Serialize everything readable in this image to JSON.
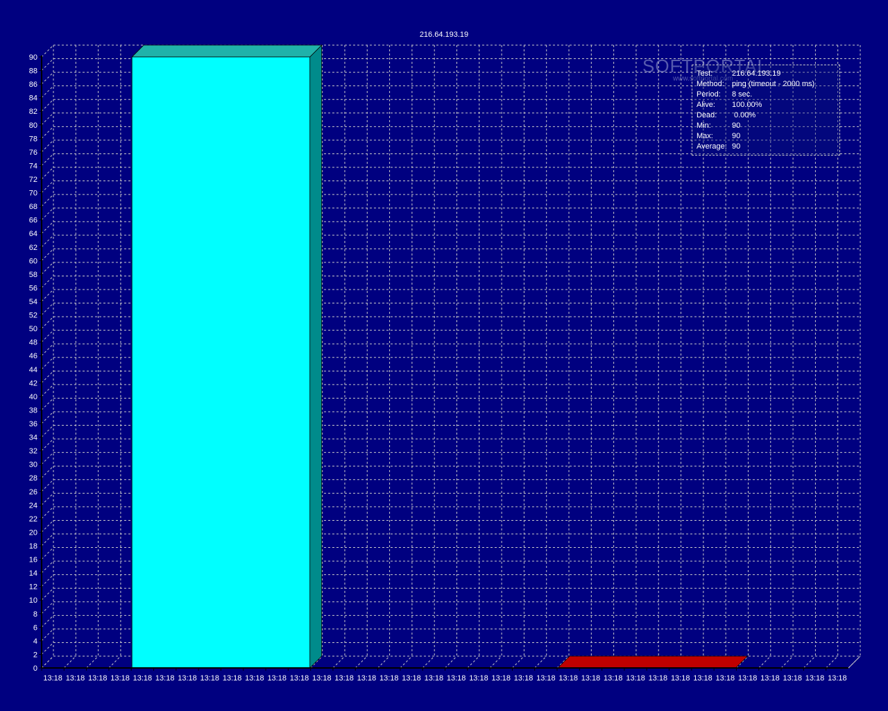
{
  "chart_data": {
    "type": "bar",
    "title": "216.64.193.19",
    "xlabel": "",
    "ylabel": "",
    "ylim": [
      0,
      90
    ],
    "ytick_step": 2,
    "grid": true,
    "style": "3d",
    "categories": [
      "13:18",
      "13:18",
      "13:18",
      "13:18",
      "13:18",
      "13:18",
      "13:18",
      "13:18",
      "13:18",
      "13:18",
      "13:18",
      "13:18",
      "13:18",
      "13:18",
      "13:18",
      "13:18",
      "13:18",
      "13:18",
      "13:18",
      "13:18",
      "13:18",
      "13:18",
      "13:18",
      "13:18",
      "13:18",
      "13:18",
      "13:18",
      "13:18",
      "13:18",
      "13:18",
      "13:18",
      "13:18",
      "13:18",
      "13:18",
      "13:18",
      "13:18"
    ],
    "series": [
      {
        "color": "#00ffff",
        "side_color": "#008b8b",
        "top_color": "#20b2aa",
        "segments": [
          {
            "start_index": 4,
            "end_index": 11,
            "value": 90
          }
        ]
      },
      {
        "color": "#c00000",
        "side_color": "#800000",
        "top_color": "#c00000",
        "segments": [
          {
            "start_index": 23,
            "end_index": 30,
            "value": 0
          }
        ]
      }
    ],
    "colors": {
      "background": "#000080",
      "grid": "#c8c8c8",
      "axis": "#000000",
      "text": "#ffffff"
    }
  },
  "info_panel": {
    "rows": [
      {
        "label": "Test:",
        "value": "216.64.193.19"
      },
      {
        "label": "Method:",
        "value": "ping (timeout - 2000 ms)"
      },
      {
        "label": "Period:",
        "value": "8 sec."
      },
      {
        "label": "Alive:",
        "value": "100.00%"
      },
      {
        "label": "Dead:",
        "value": "0.00%"
      },
      {
        "label": "Min:",
        "value": "90"
      },
      {
        "label": "Max:",
        "value": "90"
      },
      {
        "label": "Average:",
        "value": "90"
      }
    ]
  },
  "watermark": {
    "logo": "SOFTPORTAL",
    "url": "www.softportal.com"
  }
}
